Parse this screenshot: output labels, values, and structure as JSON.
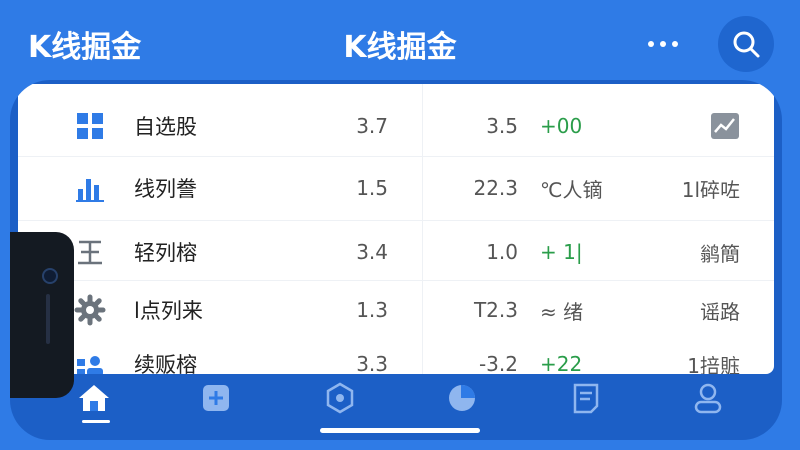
{
  "header": {
    "title_left": "K线掘金",
    "title_center": "K线掘金",
    "more_icon": "more-dots-icon",
    "search_icon": "search-icon"
  },
  "list": {
    "rows": [
      {
        "icon": "grid-icon",
        "name": "自选股",
        "v1": "3.7",
        "v2": "3.5",
        "change": "+00",
        "extra": ""
      },
      {
        "icon": "bar-chart-icon",
        "name": "线列誊",
        "v1": "1.5",
        "v2": "22.3",
        "change": "℃人镝",
        "extra": "1l碎咗"
      },
      {
        "icon": "king-icon",
        "name": "轻列榕",
        "v1": "3.4",
        "v2": "1.0",
        "change": "+ 1|",
        "extra": "鹟簡"
      },
      {
        "icon": "gear-icon",
        "name": "l点列来",
        "v1": "1.3",
        "v2": "T2.3",
        "change": "≈ 绪",
        "extra": "谣路"
      },
      {
        "icon": "users-icon",
        "name": "续贩榕",
        "v1": "3.3",
        "v2": "-3.2",
        "change": "+22",
        "extra": "1掊賘"
      }
    ]
  },
  "tabs": [
    {
      "icon": "home-icon"
    },
    {
      "icon": "plus-square-icon"
    },
    {
      "icon": "hexagon-icon"
    },
    {
      "icon": "pie-chart-icon"
    },
    {
      "icon": "note-icon"
    },
    {
      "icon": "user-icon"
    }
  ],
  "colors": {
    "primary": "#2f7be6",
    "up": "#2a9d4a"
  }
}
